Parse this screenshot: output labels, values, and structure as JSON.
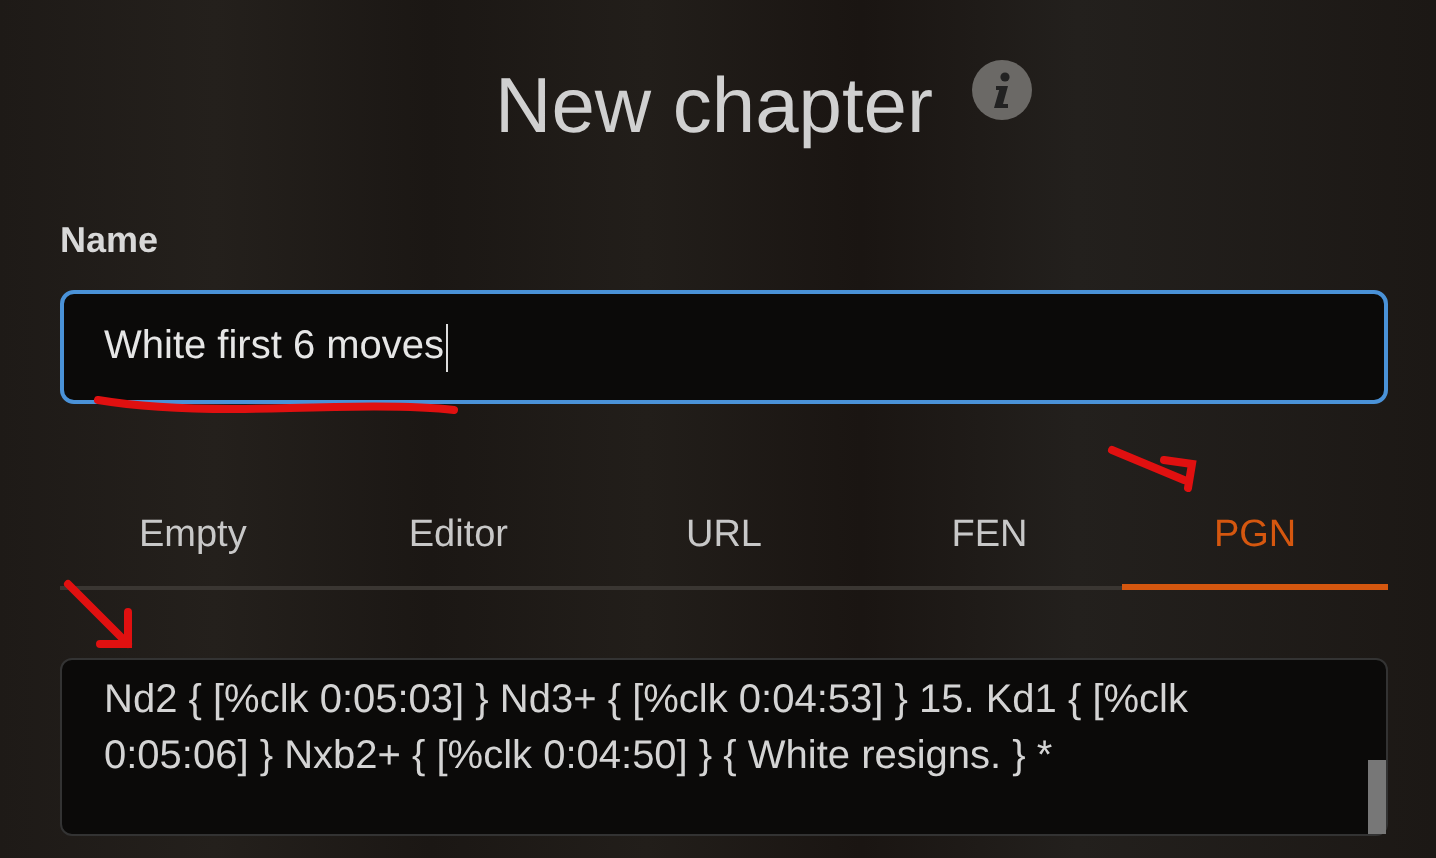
{
  "dialog": {
    "title": "New chapter"
  },
  "name_field": {
    "label": "Name",
    "value": "White first 6 moves",
    "focused": true
  },
  "tabs": [
    {
      "label": "Empty",
      "selected": false
    },
    {
      "label": "Editor",
      "selected": false
    },
    {
      "label": "URL",
      "selected": false
    },
    {
      "label": "FEN",
      "selected": false
    },
    {
      "label": "PGN",
      "selected": true
    }
  ],
  "pgn_field": {
    "value": "Nd2 { [%clk 0:05:03] } Nd3+ { [%clk 0:04:53] } 15. Kd1 { [%clk 0:05:06] } Nxb2+ { [%clk 0:04:50] } { White resigns. } *"
  }
}
